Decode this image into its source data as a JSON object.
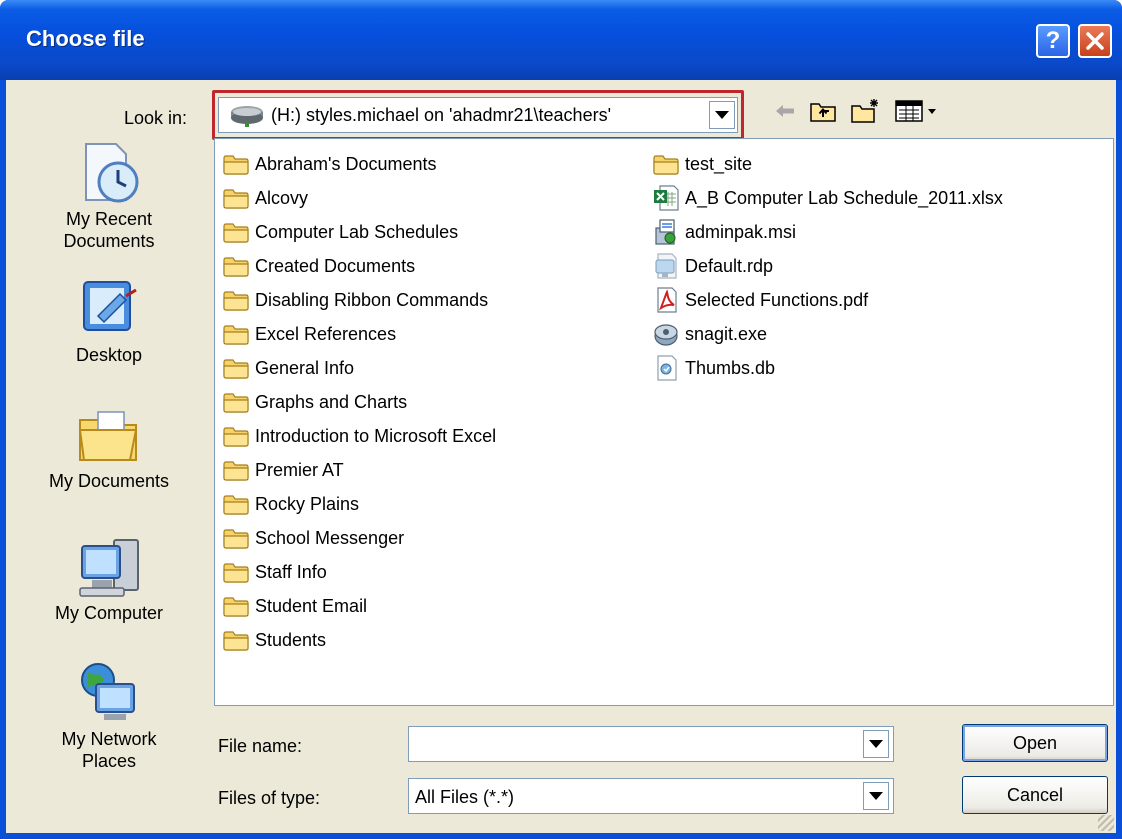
{
  "window": {
    "title": "Choose file"
  },
  "title_buttons": {
    "help": "?"
  },
  "lookin": {
    "label": "Look in:",
    "value": "(H:) styles.michael on 'ahadmr21\\teachers'"
  },
  "places": [
    {
      "label": "My Recent Documents"
    },
    {
      "label": "Desktop"
    },
    {
      "label": "My Documents"
    },
    {
      "label": "My Computer"
    },
    {
      "label": "My Network Places"
    }
  ],
  "files": {
    "column1": [
      "Abraham's Documents",
      "Alcovy",
      "Computer Lab Schedules",
      "Created Documents",
      "Disabling Ribbon Commands",
      "Excel References",
      "General Info",
      "Graphs and Charts",
      "Introduction to Microsoft Excel",
      "Premier AT",
      "Rocky Plains",
      "School Messenger",
      "Staff Info",
      "Student Email",
      "Students"
    ],
    "column2": [
      {
        "name": "test_site",
        "icon": "folder-icon"
      },
      {
        "name": "A_B Computer Lab Schedule_2011.xlsx",
        "icon": "excel-file-icon"
      },
      {
        "name": "adminpak.msi",
        "icon": "msi-installer-icon"
      },
      {
        "name": "Default.rdp",
        "icon": "remote-desktop-file-icon"
      },
      {
        "name": "Selected Functions.pdf",
        "icon": "pdf-file-icon"
      },
      {
        "name": "snagit.exe",
        "icon": "exe-file-icon"
      },
      {
        "name": "Thumbs.db",
        "icon": "db-file-icon"
      }
    ]
  },
  "form": {
    "filename_label": "File name:",
    "filename_value": "",
    "filetype_label": "Files of type:",
    "filetype_value": "All Files (*.*)",
    "open_label": "Open",
    "cancel_label": "Cancel"
  },
  "colors": {
    "titlebar": "#0a4fd8",
    "dialog": "#ece9d8",
    "highlight_box": "#c0272d"
  }
}
